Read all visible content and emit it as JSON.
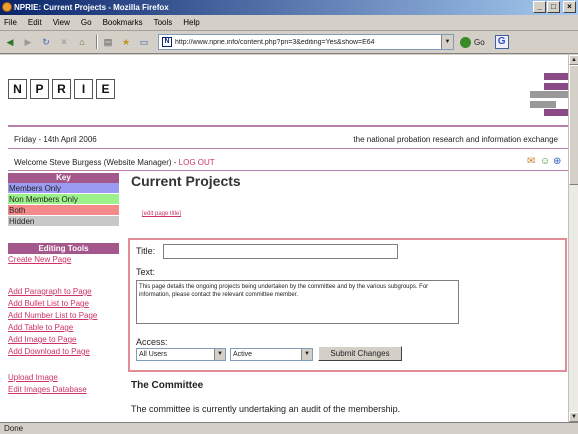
{
  "window": {
    "title": "NPRIE: Current Projects - Mozilla Firefox",
    "min": "_",
    "max": "□",
    "close": "×"
  },
  "menu": [
    "File",
    "Edit",
    "View",
    "Go",
    "Bookmarks",
    "Tools",
    "Help"
  ],
  "toolbar": {
    "url": "http://www.nprie.info/content.php?pn=3&editing=Yes&show=E64",
    "go_label": "Go",
    "search_label": "G"
  },
  "status": "Done",
  "site": {
    "logo_letters": [
      "N",
      "P",
      "R",
      "I",
      "E"
    ],
    "date": "Friday - 14th April 2006",
    "tagline": "the national probation research and information exchange",
    "welcome": "Welcome Steve Burgess (Website Manager) -",
    "logout": "LOG OUT"
  },
  "key": {
    "header": "Key",
    "items": [
      {
        "label": "Members Only",
        "color": "#9a9cf4"
      },
      {
        "label": "Non Members Only",
        "color": "#9cf28a"
      },
      {
        "label": "Both",
        "color": "#f48a8a"
      },
      {
        "label": "Hidden",
        "color": "#c8c8c8"
      }
    ]
  },
  "tools": {
    "header": "Editing Tools",
    "create": "Create New Page",
    "group1": [
      "Add Paragraph to Page",
      "Add Bullet List to Page",
      "Add Number List to Page",
      "Add Table to Page",
      "Add Image to Page",
      "Add Download to Page"
    ],
    "group2": [
      "Upload Image",
      "Edit Images Database"
    ]
  },
  "main": {
    "title": "Current Projects",
    "edit_title_link": "[edit page title]",
    "form": {
      "title_label": "Title:",
      "title_value": "",
      "text_label": "Text:",
      "text_value": "This page details the ongoing projects being undertaken by the committee and by the various subgroups. For information, please contact the relevant committee member.",
      "access_label": "Access:",
      "access_value": "All Users",
      "status_value": "Active",
      "submit_label": "Submit Changes"
    },
    "section_heading": "The Committee",
    "section_text": "The committee is currently undertaking an audit of the membership."
  }
}
